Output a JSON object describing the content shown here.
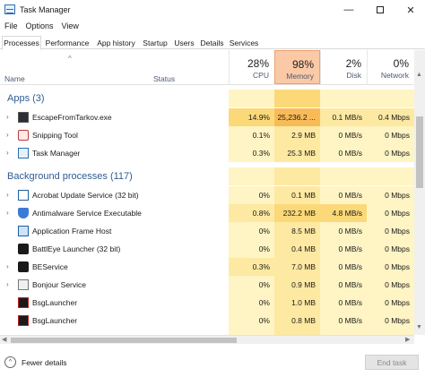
{
  "window": {
    "title": "Task Manager",
    "min_glyph": "—",
    "close_glyph": "✕"
  },
  "menu": [
    "File",
    "Options",
    "View"
  ],
  "tabs": [
    "Processes",
    "Performance",
    "App history",
    "Startup",
    "Users",
    "Details",
    "Services"
  ],
  "active_tab": "Processes",
  "columns": {
    "name": "Name",
    "status": "Status",
    "cpu": {
      "percent": "28%",
      "label": "CPU"
    },
    "memory": {
      "percent": "98%",
      "label": "Memory"
    },
    "disk": {
      "percent": "2%",
      "label": "Disk"
    },
    "network": {
      "percent": "0%",
      "label": "Network"
    }
  },
  "groups": {
    "apps": "Apps (3)",
    "background": "Background processes (117)"
  },
  "processes": [
    {
      "name": "EscapeFromTarkov.exe",
      "icon": "game-icon",
      "cpu": "14.9%",
      "memory": "25,236.2 ...",
      "disk": "0.1 MB/s",
      "network": "0.4 Mbps",
      "expandable": true
    },
    {
      "name": "Snipping Tool",
      "icon": "snipping-tool-icon",
      "cpu": "0.1%",
      "memory": "2.9 MB",
      "disk": "0 MB/s",
      "network": "0 Mbps",
      "expandable": true
    },
    {
      "name": "Task Manager",
      "icon": "task-manager-icon",
      "cpu": "0.3%",
      "memory": "25.3 MB",
      "disk": "0 MB/s",
      "network": "0 Mbps",
      "expandable": true
    },
    {
      "name": "Acrobat Update Service (32 bit)",
      "icon": "window-icon",
      "cpu": "0%",
      "memory": "0.1 MB",
      "disk": "0 MB/s",
      "network": "0 Mbps",
      "expandable": true
    },
    {
      "name": "Antimalware Service Executable",
      "icon": "shield-icon",
      "cpu": "0.8%",
      "memory": "232.2 MB",
      "disk": "4.8 MB/s",
      "network": "0 Mbps",
      "expandable": true
    },
    {
      "name": "Application Frame Host",
      "icon": "app-window-icon",
      "cpu": "0%",
      "memory": "8.5 MB",
      "disk": "0 MB/s",
      "network": "0 Mbps",
      "expandable": false
    },
    {
      "name": "BattlEye Launcher (32 bit)",
      "icon": "battleye-icon",
      "cpu": "0%",
      "memory": "0.4 MB",
      "disk": "0 MB/s",
      "network": "0 Mbps",
      "expandable": false
    },
    {
      "name": "BEService",
      "icon": "battleye-icon",
      "cpu": "0.3%",
      "memory": "7.0 MB",
      "disk": "0 MB/s",
      "network": "0 Mbps",
      "expandable": true
    },
    {
      "name": "Bonjour Service",
      "icon": "bonjour-icon",
      "cpu": "0%",
      "memory": "0.9 MB",
      "disk": "0 MB/s",
      "network": "0 Mbps",
      "expandable": true
    },
    {
      "name": "BsgLauncher",
      "icon": "bsg-icon",
      "cpu": "0%",
      "memory": "1.0 MB",
      "disk": "0 MB/s",
      "network": "0 Mbps",
      "expandable": false
    },
    {
      "name": "BsgLauncher",
      "icon": "bsg-icon",
      "cpu": "0%",
      "memory": "0.8 MB",
      "disk": "0 MB/s",
      "network": "0 Mbps",
      "expandable": false
    }
  ],
  "footer": {
    "fewer_details": "Fewer details",
    "end_task": "End task"
  },
  "colors": {
    "memory_header": "#fbc9a5",
    "heat_light": "#fff4c4",
    "heat_hot": "#f9bb58",
    "group_title": "#2e5c93"
  }
}
